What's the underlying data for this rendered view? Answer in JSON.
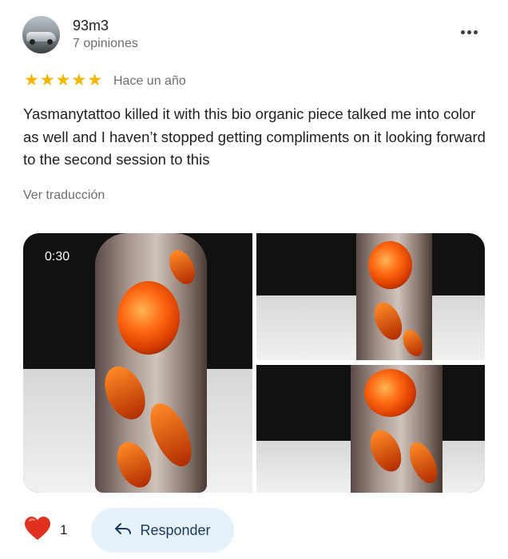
{
  "review": {
    "author": "93m3",
    "author_reviews": "7 opiniones",
    "rating": 5,
    "time_ago": "Hace un año",
    "text": "Yasmanytattoo killed it with this bio organic piece talked me into color as well and I haven’t stopped getting compliments on it looking forward to the second session to this",
    "translate_link": "Ver traducción"
  },
  "media": {
    "video_duration": "0:30",
    "items": [
      "video",
      "photo",
      "photo"
    ]
  },
  "reactions": {
    "like_count": "1",
    "reply_label": "Responder"
  },
  "colors": {
    "star": "#f4b400",
    "heart": "#e0311f",
    "reply_bg": "#e6f1fb",
    "reply_text": "#1a3a5c"
  },
  "icons": [
    "avatar",
    "more-options-icon",
    "star-icon",
    "heart-icon",
    "reply-arrow-icon"
  ]
}
